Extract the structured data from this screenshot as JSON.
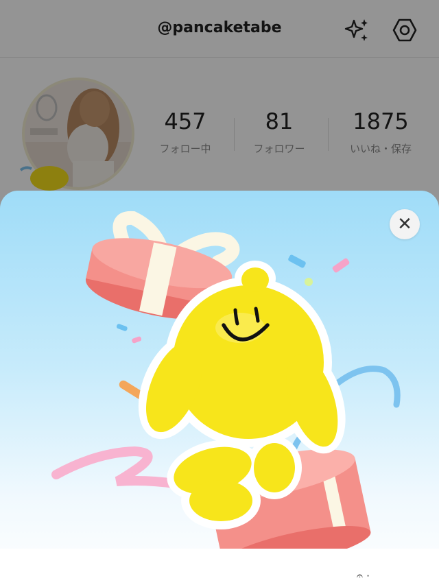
{
  "header": {
    "handle": "@pancaketabe",
    "icons": [
      "sparkle-icon",
      "settings-icon"
    ]
  },
  "profile": {
    "stats": [
      {
        "value": "457",
        "label": "フォロー中"
      },
      {
        "value": "81",
        "label": "フォロワー"
      },
      {
        "value": "1875",
        "label": "いいね・保存"
      }
    ]
  },
  "modal": {
    "close_glyph": "✕",
    "footer_text": "𝄐 ·",
    "colors": {
      "sky_top": "#9fdcf8",
      "character": "#f7e51b",
      "gift_box": "#f08a84",
      "ribbon": "#f8f3e0"
    }
  }
}
